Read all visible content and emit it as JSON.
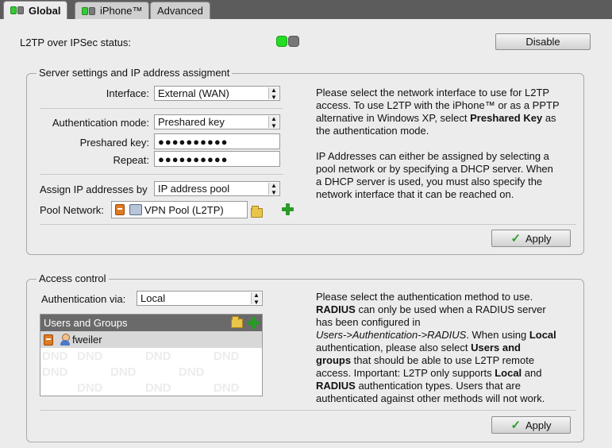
{
  "tabs": [
    {
      "label": "Global",
      "active": true,
      "icon": "led-status-icon"
    },
    {
      "label": "iPhone™",
      "active": false,
      "icon": "led-status-icon"
    },
    {
      "label": "Advanced",
      "active": false
    }
  ],
  "status": {
    "label": "L2TP over IPSec status:",
    "state": "on",
    "disable_label": "Disable"
  },
  "server": {
    "legend": "Server settings and IP address assigment",
    "interface_label": "Interface:",
    "interface_value": "External (WAN)",
    "auth_mode_label": "Authentication mode:",
    "auth_mode_value": "Preshared key",
    "psk_label": "Preshared key:",
    "psk_value": "●●●●●●●●●●",
    "repeat_label": "Repeat:",
    "repeat_value": "●●●●●●●●●●",
    "assign_label": "Assign IP addresses by",
    "assign_value": "IP address pool",
    "pool_label": "Pool Network:",
    "pool_value": "VPN Pool (L2TP)",
    "help_1": [
      "Please select the network interface to use for L2TP",
      "access. To use L2TP with the iPhone™ or as a PPTP",
      "alternative in Windows XP, select ",
      "Preshared Key",
      " as",
      "the authentication mode."
    ],
    "help_2": [
      "IP Addresses can either be assigned by selecting a",
      "pool network or by specifying a DHCP server. When",
      "a DHCP server is used, you must also specify the",
      "network interface that it can be reached on."
    ],
    "apply_label": "Apply"
  },
  "access": {
    "legend": "Access control",
    "auth_via_label": "Authentication via:",
    "auth_via_value": "Local",
    "list_title": "Users and Groups",
    "users": [
      "fweiler"
    ],
    "watermark": "DND",
    "help": {
      "l1": "Please select the authentication method to use.",
      "l2a": "RADIUS",
      "l2b": " can only be used when a RADIUS server",
      "l3": "has been configured in",
      "l4a": "Users->Authentication->RADIUS",
      "l4b": ". When using ",
      "l4c": "Local",
      "l5a": "authentication, please also select ",
      "l5b": "Users and",
      "l6a": "groups",
      "l6b": " that should be able to use L2TP remote",
      "l7a": "access. Important: L2TP only supports ",
      "l7b": "Local",
      "l7c": " and",
      "l8a": "RADIUS",
      "l8b": " authentication types. Users that are",
      "l9": "authenticated against other methods will not work."
    },
    "apply_label": "Apply"
  },
  "colors": {
    "tabbar": "#5c5c5c",
    "status_on": "#22dd22",
    "accent_green": "#2a9a2a"
  }
}
